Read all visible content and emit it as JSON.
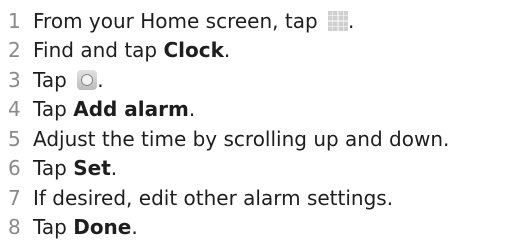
{
  "steps": [
    {
      "num": "1",
      "pre": "From your Home screen, tap ",
      "post": "."
    },
    {
      "num": "2",
      "pre": "Find and tap ",
      "bold": "Clock",
      "post": "."
    },
    {
      "num": "3",
      "pre": "Tap ",
      "post": "."
    },
    {
      "num": "4",
      "pre": "Tap ",
      "bold": "Add alarm",
      "post": "."
    },
    {
      "num": "5",
      "text": "Adjust the time by scrolling up and down."
    },
    {
      "num": "6",
      "pre": "Tap ",
      "bold": "Set",
      "post": "."
    },
    {
      "num": "7",
      "text": "If desired, edit other alarm settings."
    },
    {
      "num": "8",
      "pre": "Tap ",
      "bold": "Done",
      "post": "."
    }
  ],
  "icons": {
    "step1": "application-grid-icon",
    "step3": "alarm-clock-icon"
  }
}
